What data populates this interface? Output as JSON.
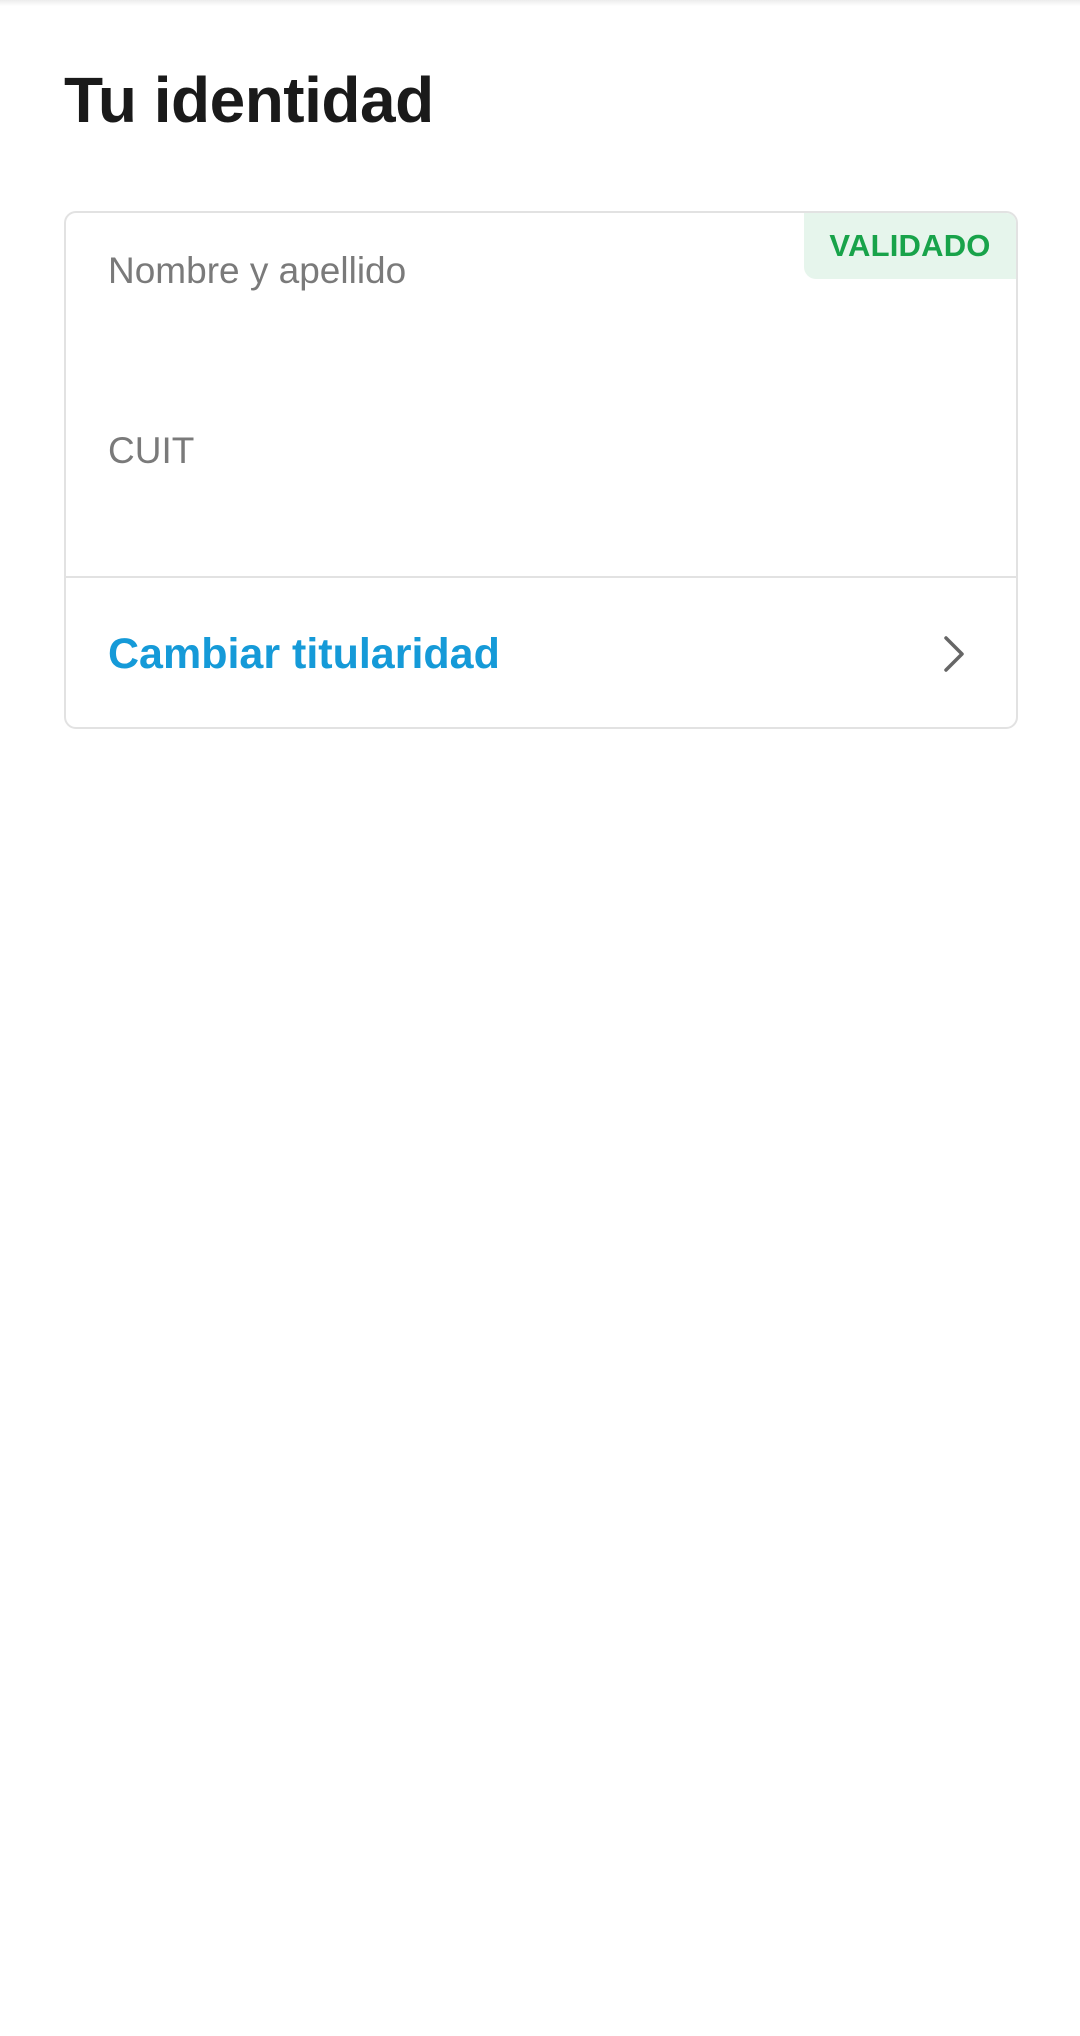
{
  "page": {
    "title": "Tu identidad"
  },
  "identity_card": {
    "status_badge": "VALIDADO",
    "fields": [
      {
        "label": "Nombre y apellido",
        "value": ""
      },
      {
        "label": "CUIT",
        "value": ""
      }
    ],
    "action": {
      "label": "Cambiar titularidad",
      "icon": "chevron-right-icon"
    }
  },
  "colors": {
    "badge_text": "#18a34a",
    "badge_bg": "#e6f5ec",
    "action_link": "#159ad8",
    "title_text": "#1a1a1a",
    "label_text": "#7a7a7a"
  }
}
